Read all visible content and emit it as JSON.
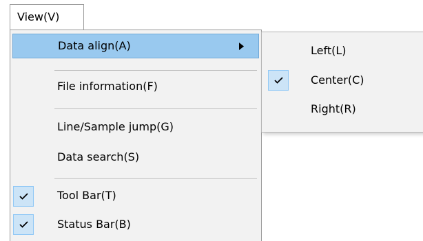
{
  "menubar": {
    "view_menu_label": "View(V)"
  },
  "view_menu": {
    "items": [
      {
        "label": "Data align(A)",
        "has_submenu": true,
        "highlighted": true
      },
      {
        "label": "File information(F)"
      },
      {
        "label": "Line/Sample jump(G)"
      },
      {
        "label": "Data search(S)"
      },
      {
        "label": "Tool Bar(T)",
        "checked": true
      },
      {
        "label": "Status Bar(B)",
        "checked": true
      }
    ]
  },
  "data_align_submenu": {
    "items": [
      {
        "label": "Left(L)",
        "checked": false
      },
      {
        "label": "Center(C)",
        "checked": true
      },
      {
        "label": "Right(R)",
        "checked": false
      }
    ]
  },
  "icons": {
    "check": "check-icon",
    "submenu_arrow": "chevron-right-icon"
  },
  "colors": {
    "highlight_bg": "#99c9ef",
    "highlight_border": "#6fa8d8",
    "check_bg": "#cce4f7",
    "check_border": "#90c8f6",
    "menu_bg": "#f2f2f2"
  }
}
